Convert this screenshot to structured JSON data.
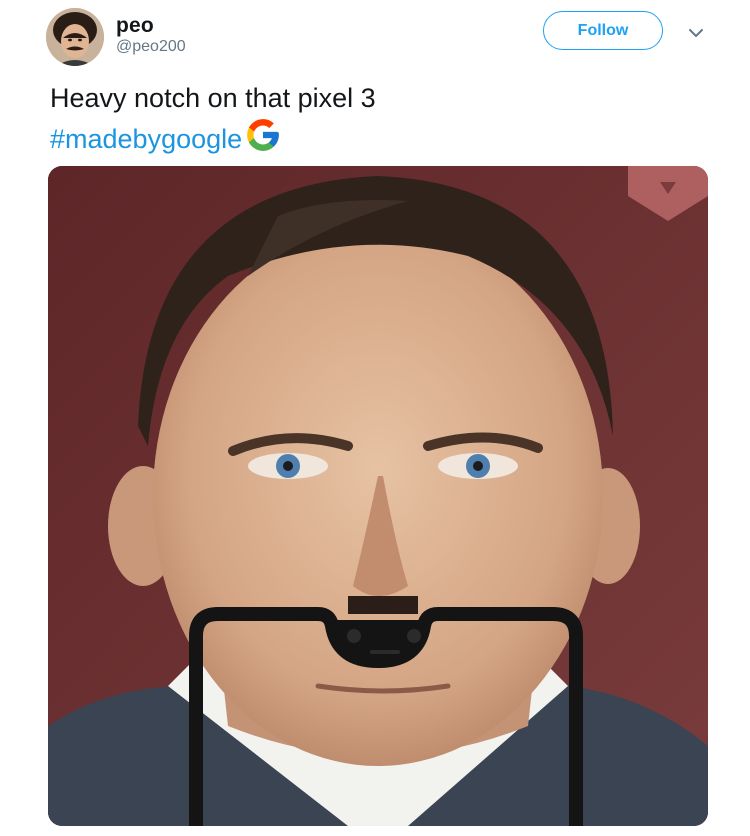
{
  "user": {
    "display_name": "peo",
    "handle": "@peo200",
    "avatar_icon": "user-avatar"
  },
  "actions": {
    "follow_label": "Follow",
    "more_icon": "chevron-down-icon"
  },
  "tweet": {
    "text": "Heavy notch on that pixel 3",
    "hashtag": "#madebygoogle",
    "inline_icon": "google-g-logo"
  },
  "media": {
    "subject": "photo-of-man-with-phone-notch-overlay"
  },
  "colors": {
    "accent": "#1da1f2",
    "hashtag": "#1b95e0",
    "text": "#14171a",
    "muted": "#657786",
    "photo_background": "#6e3234"
  }
}
